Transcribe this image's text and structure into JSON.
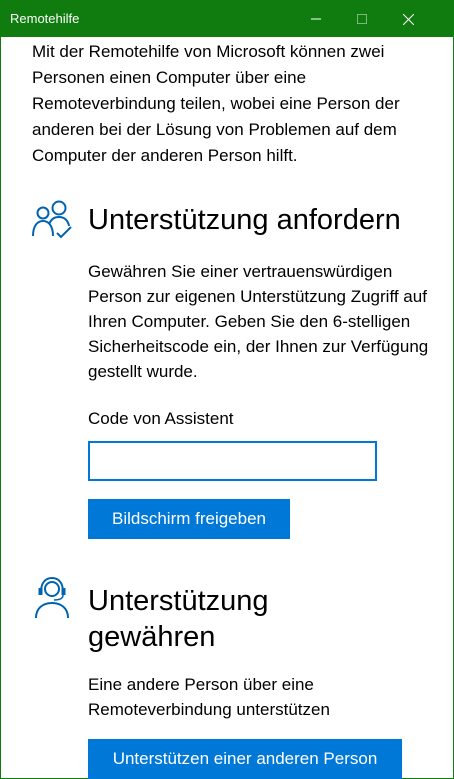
{
  "window": {
    "title": "Remotehilfe",
    "accent_color": "#107c10",
    "controls": [
      "minimize-icon",
      "maximize-icon",
      "close-icon"
    ]
  },
  "intro": "Mit der Remotehilfe von Microsoft können zwei Personen einen Computer über eine Remoteverbindung teilen, wobei eine Person der anderen bei der Lösung von Problemen auf dem Computer der anderen Person hilft.",
  "request_section": {
    "icon": "people-check-icon",
    "heading": "Unterstützung anfordern",
    "description": "Gewähren Sie einer vertrauenswürdigen Person zur eigenen Unterstützung Zugriff auf Ihren Computer. Geben Sie den 6-stelligen Sicherheitscode ein, der Ihnen zur Verfügung gestellt wurde.",
    "code_label": "Code von Assistent",
    "code_value": "",
    "button_label": "Bildschirm freigeben"
  },
  "provide_section": {
    "icon": "headset-person-icon",
    "heading_line1": "Unterstützung",
    "heading_line2": "gewähren",
    "description": "Eine andere Person über eine Remoteverbindung unterstützen",
    "button_label": "Unterstützen einer anderen Person"
  },
  "colors": {
    "button_blue": "#0078d7",
    "icon_blue": "#0063b1"
  }
}
